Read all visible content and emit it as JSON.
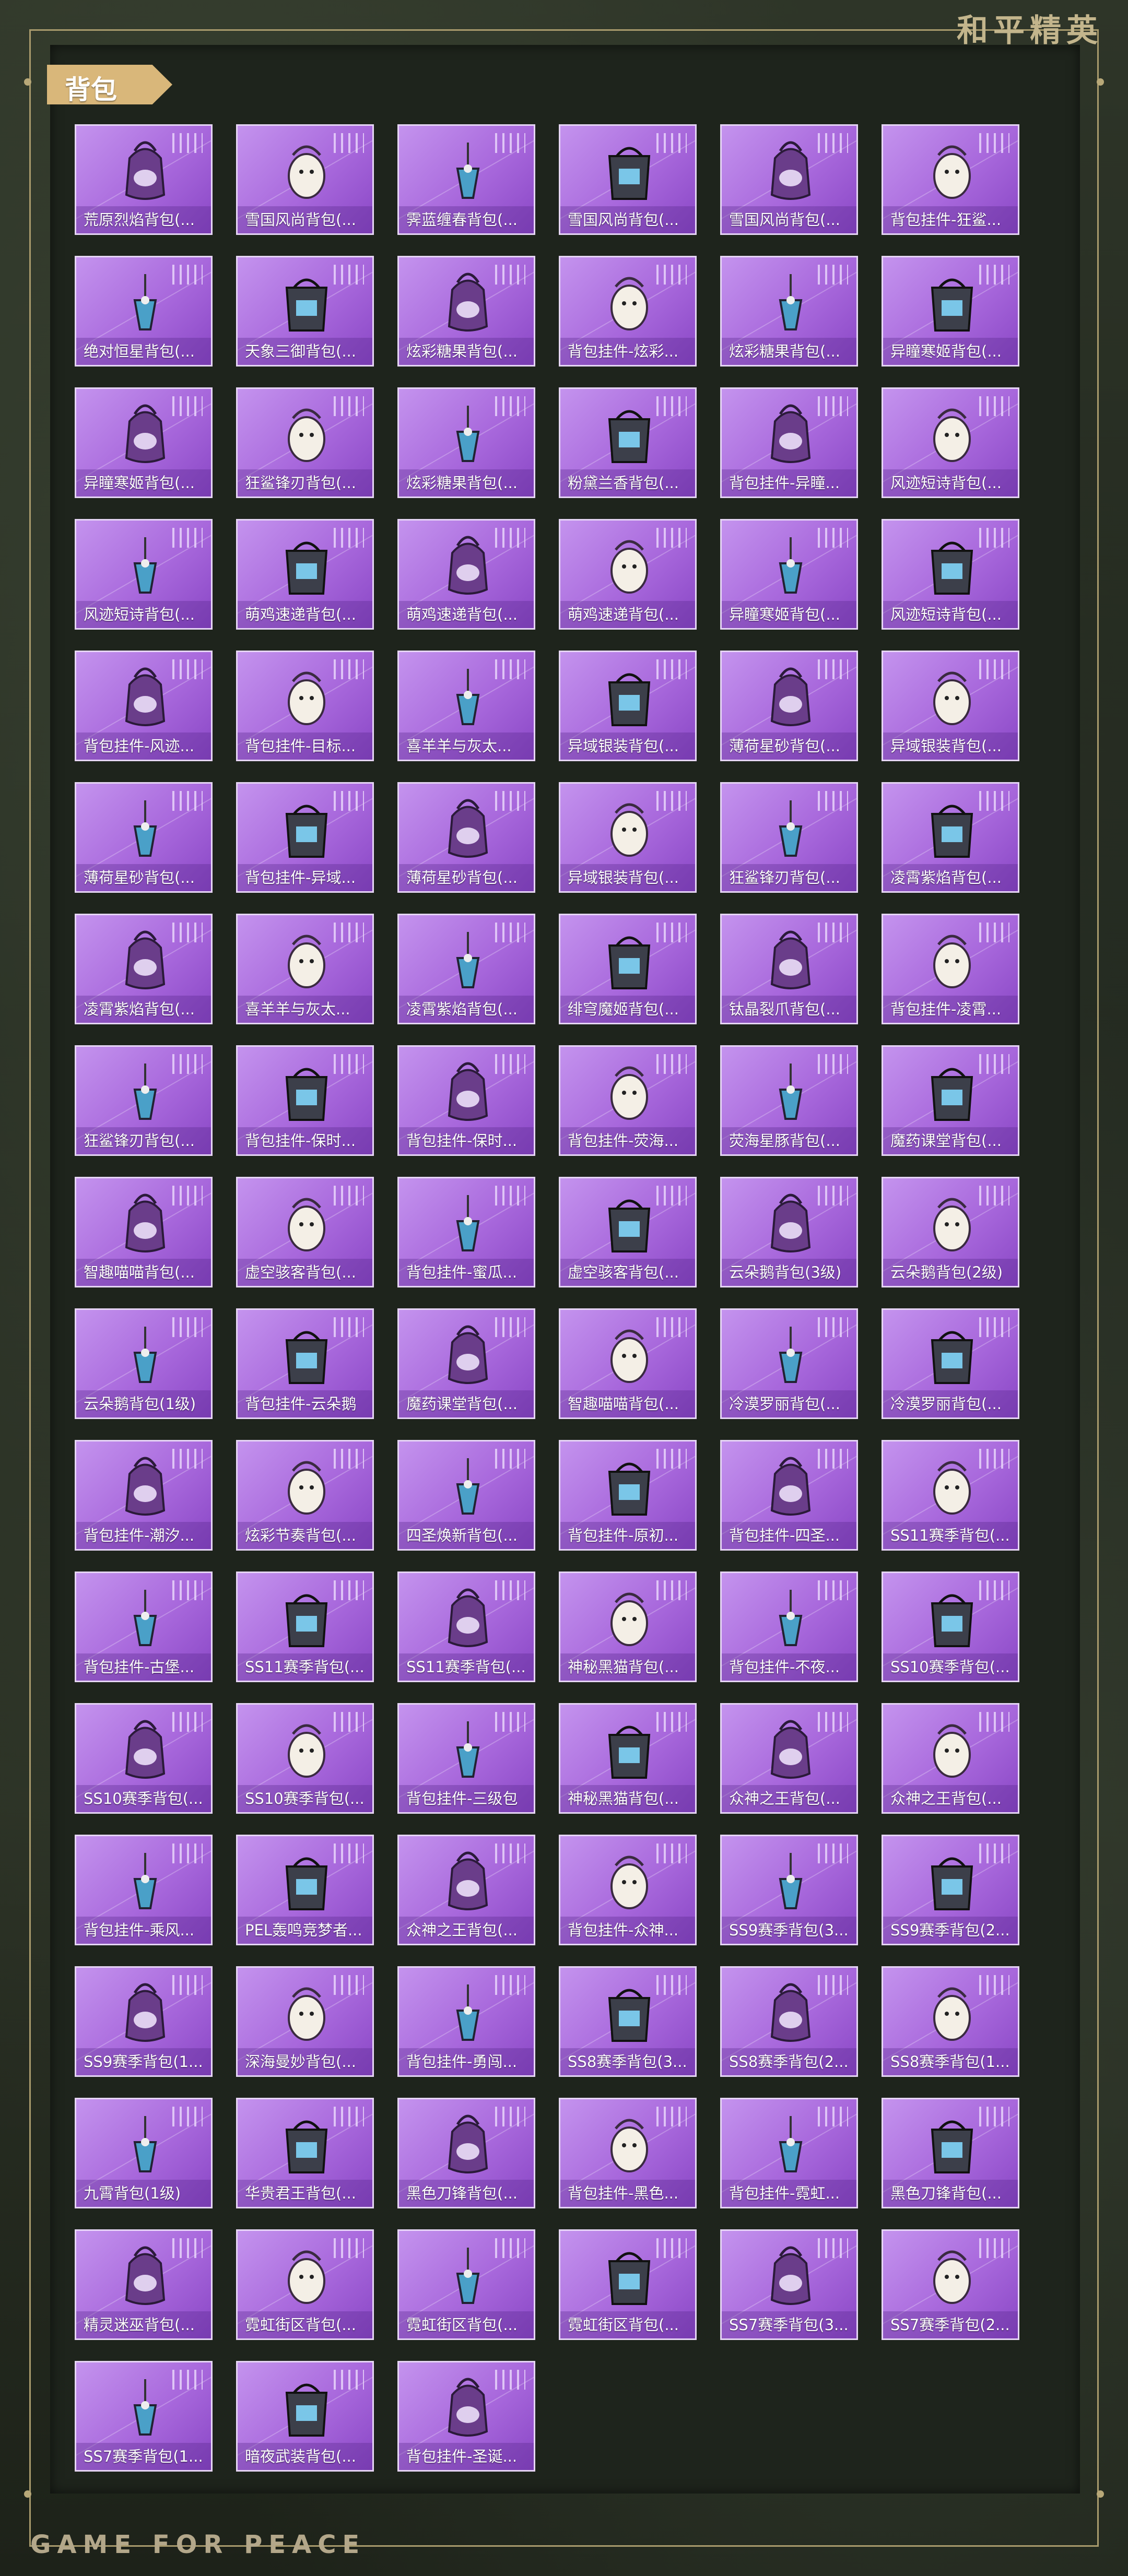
{
  "brand": "和平精英",
  "footer_brand": "GAME FOR PEACE",
  "section": {
    "title": "背包"
  },
  "colors": {
    "tile": "#a868dc",
    "tile_border": "#e6d5f5",
    "accent": "#d9b77a"
  },
  "items": [
    "荒原烈焰背包(...",
    "雪国风尚背包(...",
    "霁蓝缠春背包(...",
    "雪国风尚背包(...",
    "雪国风尚背包(...",
    "背包挂件-狂鲨...",
    "绝对恒星背包(...",
    "天象三御背包(...",
    "炫彩糖果背包(...",
    "背包挂件-炫彩...",
    "炫彩糖果背包(...",
    "异瞳寒姬背包(...",
    "异瞳寒姬背包(...",
    "狂鲨锋刃背包(...",
    "炫彩糖果背包(...",
    "粉黛兰香背包(...",
    "背包挂件-异瞳...",
    "风迹短诗背包(...",
    "风迹短诗背包(...",
    "萌鸡速递背包(...",
    "萌鸡速递背包(...",
    "萌鸡速递背包(...",
    "异瞳寒姬背包(...",
    "风迹短诗背包(...",
    "背包挂件-风迹...",
    "背包挂件-目标...",
    "喜羊羊与灰太...",
    "异域银装背包(...",
    "薄荷星砂背包(...",
    "异域银装背包(...",
    "薄荷星砂背包(...",
    "背包挂件-异域...",
    "薄荷星砂背包(...",
    "异域银装背包(...",
    "狂鲨锋刃背包(...",
    "凌霄紫焰背包(...",
    "凌霄紫焰背包(...",
    "喜羊羊与灰太...",
    "凌霄紫焰背包(...",
    "绯穹魔姬背包(...",
    "钛晶裂爪背包(...",
    "背包挂件-凌霄...",
    "狂鲨锋刃背包(...",
    "背包挂件-保时...",
    "背包挂件-保时...",
    "背包挂件-荧海...",
    "荧海星豚背包(...",
    "魔药课堂背包(...",
    "智趣喵喵背包(...",
    "虚空骇客背包(...",
    "背包挂件-蜜瓜...",
    "虚空骇客背包(...",
    "云朵鹅背包(3级)",
    "云朵鹅背包(2级)",
    "云朵鹅背包(1级)",
    "背包挂件-云朵鹅",
    "魔药课堂背包(...",
    "智趣喵喵背包(...",
    "冷漠罗丽背包(...",
    "冷漠罗丽背包(...",
    "背包挂件-潮汐...",
    "炫彩节奏背包(...",
    "四圣焕新背包(...",
    "背包挂件-原初...",
    "背包挂件-四圣...",
    "SS11赛季背包(...",
    "背包挂件-古堡...",
    "SS11赛季背包(...",
    "SS11赛季背包(...",
    "神秘黑猫背包(...",
    "背包挂件-不夜...",
    "SS10赛季背包(...",
    "SS10赛季背包(...",
    "SS10赛季背包(...",
    "背包挂件-三级包",
    "神秘黑猫背包(...",
    "众神之王背包(...",
    "众神之王背包(...",
    "背包挂件-乘风...",
    "PEL轰鸣竞梦者...",
    "众神之王背包(...",
    "背包挂件-众神...",
    "SS9赛季背包(3...",
    "SS9赛季背包(2...",
    "SS9赛季背包(1...",
    "深海曼妙背包(...",
    "背包挂件-勇闯...",
    "SS8赛季背包(3...",
    "SS8赛季背包(2...",
    "SS8赛季背包(1...",
    "九霄背包(1级)",
    "华贵君王背包(...",
    "黑色刀锋背包(...",
    "背包挂件-黑色...",
    "背包挂件-霓虹...",
    "黑色刀锋背包(...",
    "精灵迷巫背包(...",
    "霓虹街区背包(...",
    "霓虹街区背包(...",
    "霓虹街区背包(...",
    "SS7赛季背包(3...",
    "SS7赛季背包(2...",
    "SS7赛季背包(1...",
    "暗夜武装背包(...",
    "背包挂件-圣诞..."
  ]
}
